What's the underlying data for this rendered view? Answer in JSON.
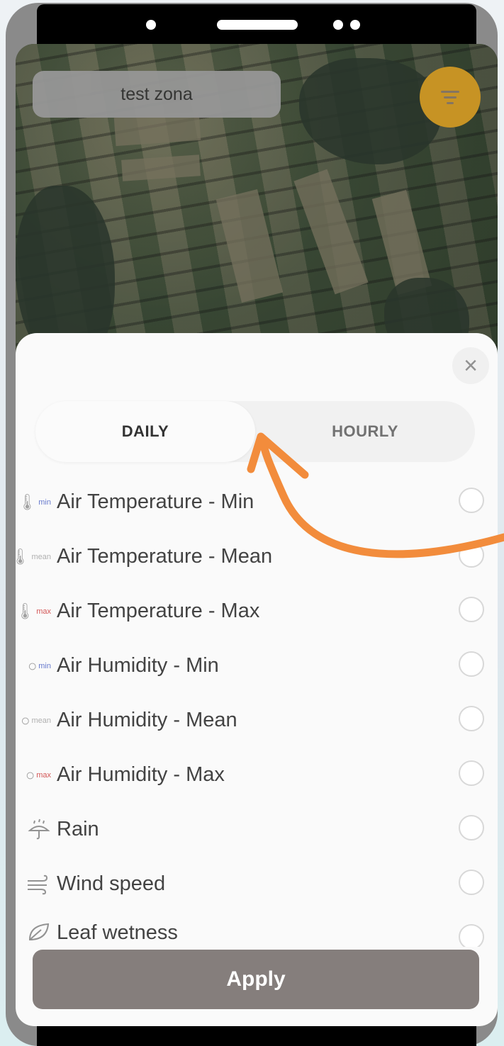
{
  "map": {
    "zone_name": "test zona",
    "filter_icon": "filter-icon"
  },
  "sheet": {
    "close_symbol": "×",
    "tabs": [
      {
        "label": "DAILY",
        "selected": true
      },
      {
        "label": "HOURLY",
        "selected": false
      }
    ],
    "items": [
      {
        "label": "Air Temperature - Min",
        "icon": "thermometer-icon",
        "icon_sub": "min",
        "selected": false
      },
      {
        "label": "Air Temperature - Mean",
        "icon": "thermometer-icon",
        "icon_sub": "mean",
        "selected": false
      },
      {
        "label": "Air Temperature - Max",
        "icon": "thermometer-icon",
        "icon_sub": "max",
        "selected": false
      },
      {
        "label": "Air Humidity - Min",
        "icon": "droplet-icon",
        "icon_sub": "min",
        "selected": false
      },
      {
        "label": "Air Humidity - Mean",
        "icon": "droplet-icon",
        "icon_sub": "mean",
        "selected": false
      },
      {
        "label": "Air Humidity - Max",
        "icon": "droplet-icon",
        "icon_sub": "max",
        "selected": false
      },
      {
        "label": "Rain",
        "icon": "umbrella-rain-icon",
        "icon_sub": "",
        "selected": false
      },
      {
        "label": "Wind speed",
        "icon": "wind-icon",
        "icon_sub": "",
        "selected": false
      },
      {
        "label": "Leaf wetness",
        "icon": "leaf-icon",
        "icon_sub": "",
        "selected": false
      }
    ],
    "apply_label": "Apply"
  },
  "colors": {
    "filter_button": "#c38a12",
    "apply_button": "#7b7471",
    "annotation_arrow": "#f28c3c",
    "min_label": "#5b6fc9",
    "max_label": "#d04a4a"
  }
}
